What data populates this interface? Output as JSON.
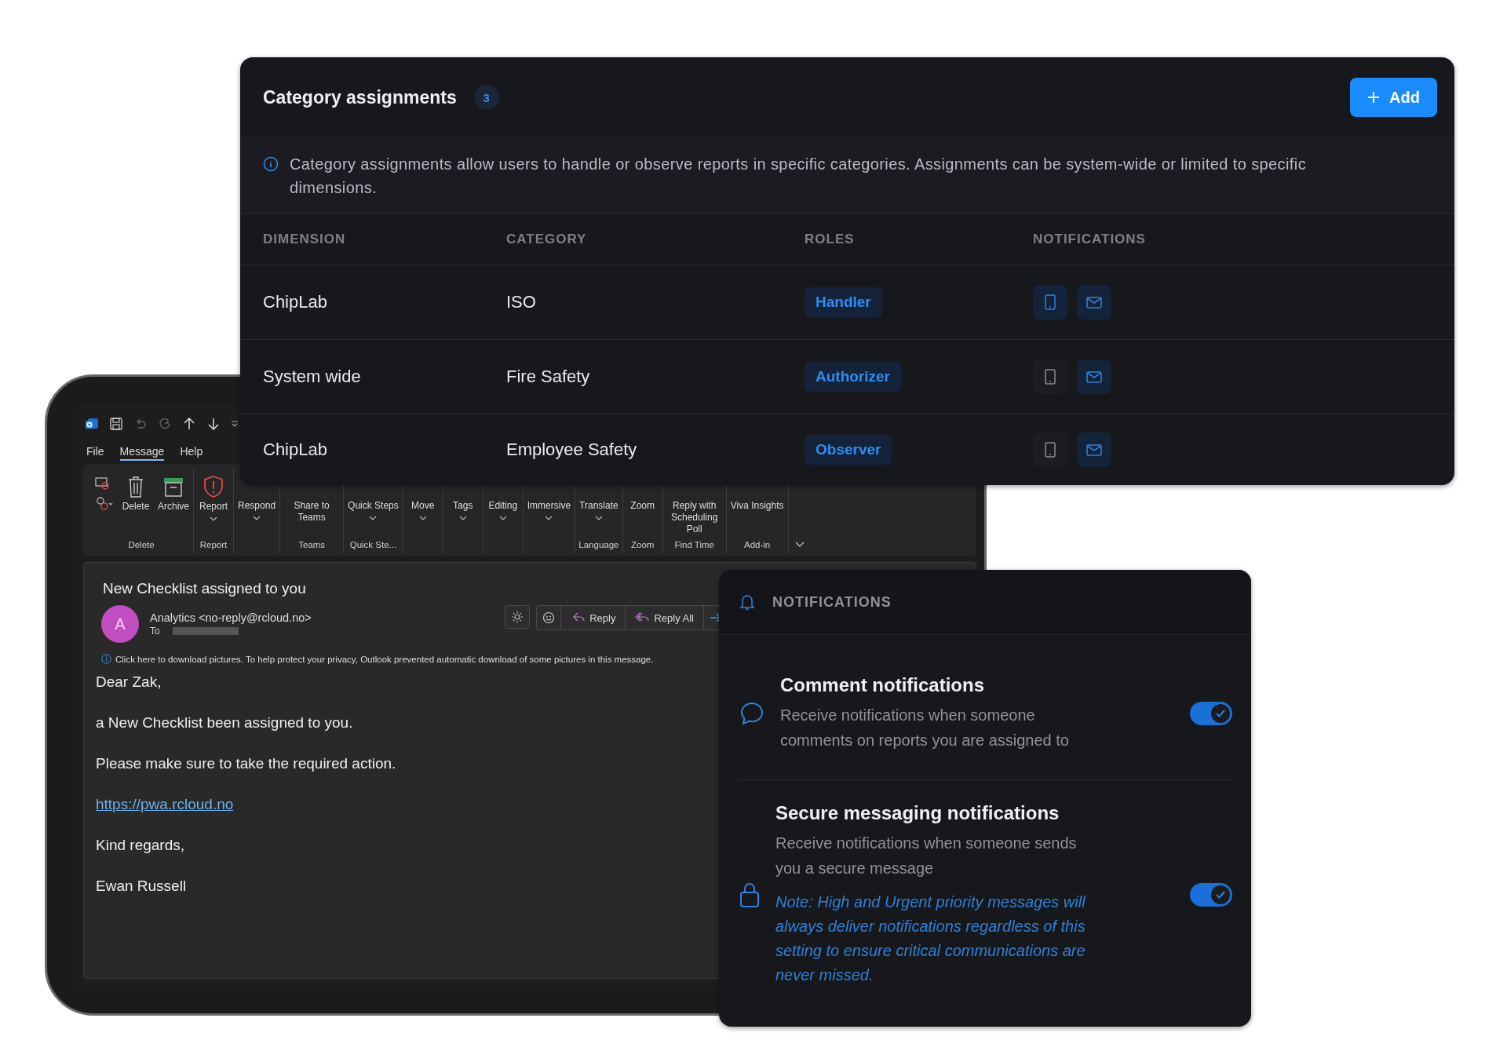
{
  "email_client": {
    "tabs": [
      {
        "label": "File",
        "selected": false
      },
      {
        "label": "Message",
        "selected": true
      },
      {
        "label": "Help",
        "selected": false
      }
    ],
    "ribbon_groups": [
      {
        "label": "Delete",
        "buttons": [
          {
            "kind": "junk",
            "dropdown": true
          },
          {
            "kind": "trash",
            "label": "Delete",
            "dropdown": false
          },
          {
            "kind": "archive",
            "label": "Archive",
            "dropdown": false
          }
        ]
      },
      {
        "label": "Report",
        "buttons": [
          {
            "kind": "shield",
            "label": "Report",
            "dropdown": true
          }
        ]
      },
      {
        "buttons": [
          {
            "label": "Respond",
            "dropdown": true
          }
        ]
      },
      {
        "label": "Teams",
        "buttons": [
          {
            "label": "Share to Teams",
            "dropdown": false
          }
        ]
      },
      {
        "label": "Quick Ste...",
        "buttons": [
          {
            "label": "Quick Steps",
            "dropdown": true
          }
        ]
      },
      {
        "buttons": [
          {
            "label": "Move",
            "dropdown": true
          }
        ]
      },
      {
        "buttons": [
          {
            "label": "Tags",
            "dropdown": true
          }
        ]
      },
      {
        "buttons": [
          {
            "label": "Editing",
            "dropdown": true
          }
        ]
      },
      {
        "buttons": [
          {
            "label": "Immersive",
            "dropdown": true
          }
        ]
      },
      {
        "label": "Language",
        "buttons": [
          {
            "label": "Translate",
            "dropdown": true
          }
        ]
      },
      {
        "label": "Zoom",
        "buttons": [
          {
            "label": "Zoom",
            "dropdown": false
          }
        ]
      },
      {
        "label": "Find Time",
        "buttons": [
          {
            "label": "Reply with Scheduling Poll",
            "dropdown": false
          }
        ]
      },
      {
        "label": "Add-in",
        "buttons": [
          {
            "label": "Viva Insights",
            "dropdown": false
          }
        ]
      }
    ],
    "message": {
      "subject": "New Checklist assigned to you",
      "avatar": "A",
      "sender": "Analytics <no-reply@rcloud.no>",
      "to_label": "To",
      "actions": [
        "Reply",
        "Reply All"
      ],
      "notice": "Click here to download pictures. To help protect your privacy, Outlook prevented automatic download of some pictures in this message.",
      "body": [
        {
          "kind": "text",
          "text": "Dear Zak,"
        },
        {
          "kind": "text",
          "text": "a New Checklist been assigned to you."
        },
        {
          "kind": "text",
          "text": "Please make sure to take the required action."
        },
        {
          "kind": "link",
          "text": "https://pwa.rcloud.no"
        },
        {
          "kind": "text",
          "text": "Kind regards,"
        },
        {
          "kind": "text",
          "text": "Ewan Russell"
        }
      ]
    }
  },
  "category_assignments": {
    "title": "Category assignments",
    "count": "3",
    "add_button": "Add",
    "info": "Category assignments allow users to handle or observe reports in specific categories. Assignments can be system-wide or limited to specific dimensions.",
    "columns": [
      "DIMENSION",
      "CATEGORY",
      "ROLES",
      "NOTIFICATIONS"
    ],
    "rows": [
      {
        "dimension": "ChipLab",
        "category": "ISO",
        "role": "Handler",
        "push": true,
        "email": true
      },
      {
        "dimension": "System wide",
        "category": "Fire Safety",
        "role": "Authorizer",
        "push": false,
        "email": true
      },
      {
        "dimension": "ChipLab",
        "category": "Employee Safety",
        "role": "Observer",
        "push": false,
        "email": true
      }
    ]
  },
  "notifications": {
    "title": "NOTIFICATIONS",
    "items": [
      {
        "kind": "comment",
        "title": "Comment notifications",
        "description": "Receive notifications when someone comments on reports you are assigned to",
        "on": true
      },
      {
        "kind": "lock",
        "title": "Secure messaging notifications",
        "description": "Receive notifications when someone sends you a secure message",
        "note": "Note: High and Urgent priority messages will always deliver notifications regardless of this setting to ensure critical communications are never missed.",
        "on": true
      }
    ]
  }
}
